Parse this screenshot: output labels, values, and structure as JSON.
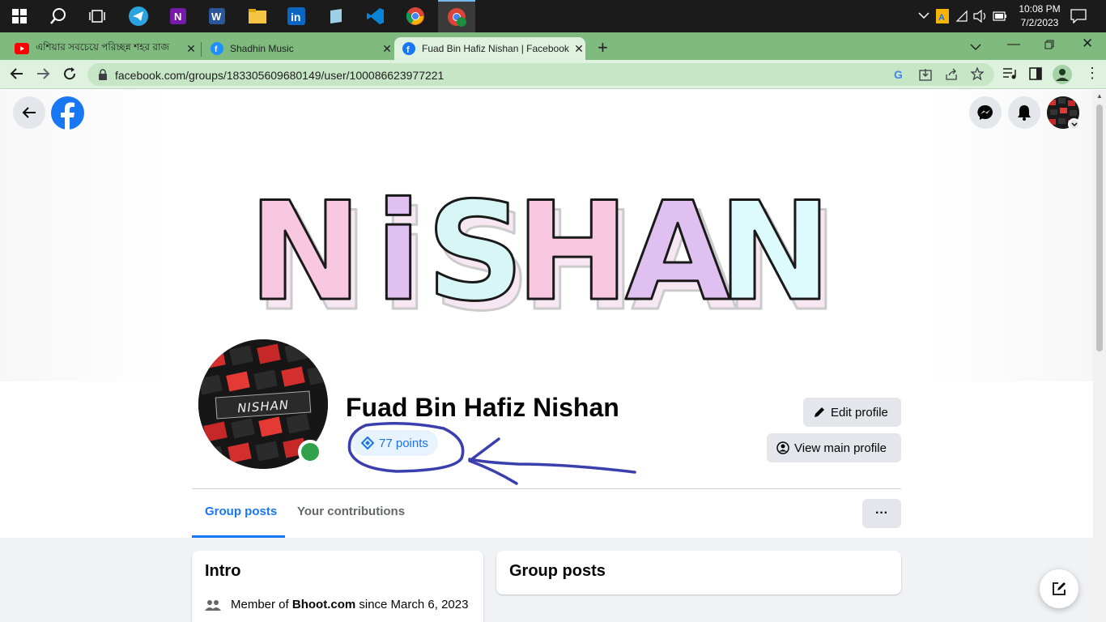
{
  "taskbar": {
    "apps": [
      {
        "name": "windows-start-icon"
      },
      {
        "name": "search-icon"
      },
      {
        "name": "task-view-icon"
      },
      {
        "name": "telegram-icon"
      },
      {
        "name": "onenote-icon"
      },
      {
        "name": "word-icon"
      },
      {
        "name": "file-explorer-icon"
      },
      {
        "name": "linkedin-icon"
      },
      {
        "name": "notepad-icon"
      },
      {
        "name": "vscode-icon"
      },
      {
        "name": "chrome-icon"
      },
      {
        "name": "chrome-profile-icon"
      }
    ],
    "time": "10:08 PM",
    "date": "7/2/2023"
  },
  "browser": {
    "tabs": [
      {
        "title": "এশিয়ার সবচেয়ে পরিচ্ছন্ন শহর রাজ",
        "icon": "youtube-icon",
        "active": false
      },
      {
        "title": "Shadhin Music",
        "icon": "shadhin-icon",
        "active": false
      },
      {
        "title": "Fuad Bin Hafiz Nishan | Facebook",
        "icon": "facebook-icon",
        "active": true
      }
    ],
    "new_tab_label": "+",
    "url": "facebook.com/groups/183305609680149/user/100086623977221"
  },
  "facebook": {
    "cover_text": "NiSHAN",
    "avatar_text": "NISHAN",
    "profile_name": "Fuad Bin Hafiz Nishan",
    "points_label": "77 points",
    "edit_profile_label": "Edit profile",
    "view_main_profile_label": "View main profile",
    "tabs": {
      "group_posts": "Group posts",
      "your_contributions": "Your contributions"
    },
    "more_label": "···",
    "intro": {
      "title": "Intro",
      "member_prefix": "Member of",
      "group_name": "Bhoot.com",
      "since_text": "since March 6, 2023"
    },
    "group_posts_card_title": "Group posts"
  },
  "colors": {
    "facebook_blue": "#1877f2",
    "chip_bg": "#e7f3ff",
    "online_green": "#31a24c",
    "annotation_ink": "#3b3fae"
  }
}
